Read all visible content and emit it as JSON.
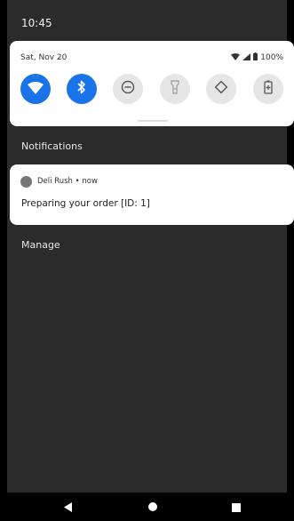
{
  "status_bar": {
    "time": "10:45"
  },
  "quick_settings": {
    "date": "Sat, Nov 20",
    "battery_percent": "100%",
    "tiles": [
      {
        "name": "wifi",
        "state": "on"
      },
      {
        "name": "bluetooth",
        "state": "on"
      },
      {
        "name": "do-not-disturb",
        "state": "off"
      },
      {
        "name": "flashlight",
        "state": "off"
      },
      {
        "name": "auto-rotate",
        "state": "off"
      },
      {
        "name": "battery-saver",
        "state": "off"
      }
    ]
  },
  "notifications": {
    "section_title": "Notifications",
    "items": [
      {
        "app": "Deli Rush",
        "separator": " • ",
        "time": "now",
        "body": "Preparing your order [ID: 1]"
      }
    ],
    "manage_label": "Manage"
  },
  "colors": {
    "accent": "#1a73e8",
    "shade_bg": "#2b2b2b",
    "card_bg": "#ffffff"
  }
}
